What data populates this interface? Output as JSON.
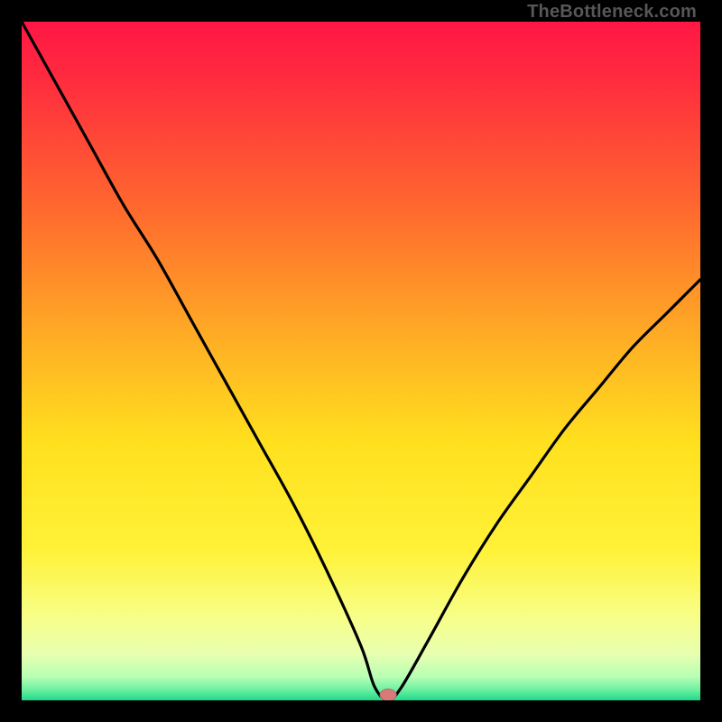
{
  "watermark": "TheBottleneck.com",
  "chart_data": {
    "type": "line",
    "title": "",
    "xlabel": "",
    "ylabel": "",
    "xlim": [
      0,
      100
    ],
    "ylim": [
      0,
      100
    ],
    "grid": false,
    "colors": {
      "gradient_top": "#ff1744",
      "gradient_mid_upper": "#ff7a2a",
      "gradient_mid": "#ffd91f",
      "gradient_lower": "#f6ff8a",
      "gradient_bottom": "#1de38a",
      "curve": "#000000",
      "marker_fill": "#d87a7a",
      "marker_stroke": "#c06868",
      "frame": "#000000"
    },
    "marker": {
      "x": 54,
      "y": 0
    },
    "series": [
      {
        "name": "bottleneck-curve",
        "x": [
          0,
          5,
          10,
          15,
          20,
          25,
          30,
          35,
          40,
          45,
          50,
          52,
          54,
          56,
          60,
          65,
          70,
          75,
          80,
          85,
          90,
          95,
          100
        ],
        "y": [
          100,
          91,
          82,
          73,
          65,
          56,
          47,
          38,
          29,
          19,
          8,
          2,
          0,
          2,
          9,
          18,
          26,
          33,
          40,
          46,
          52,
          57,
          62
        ]
      }
    ],
    "annotations": []
  }
}
